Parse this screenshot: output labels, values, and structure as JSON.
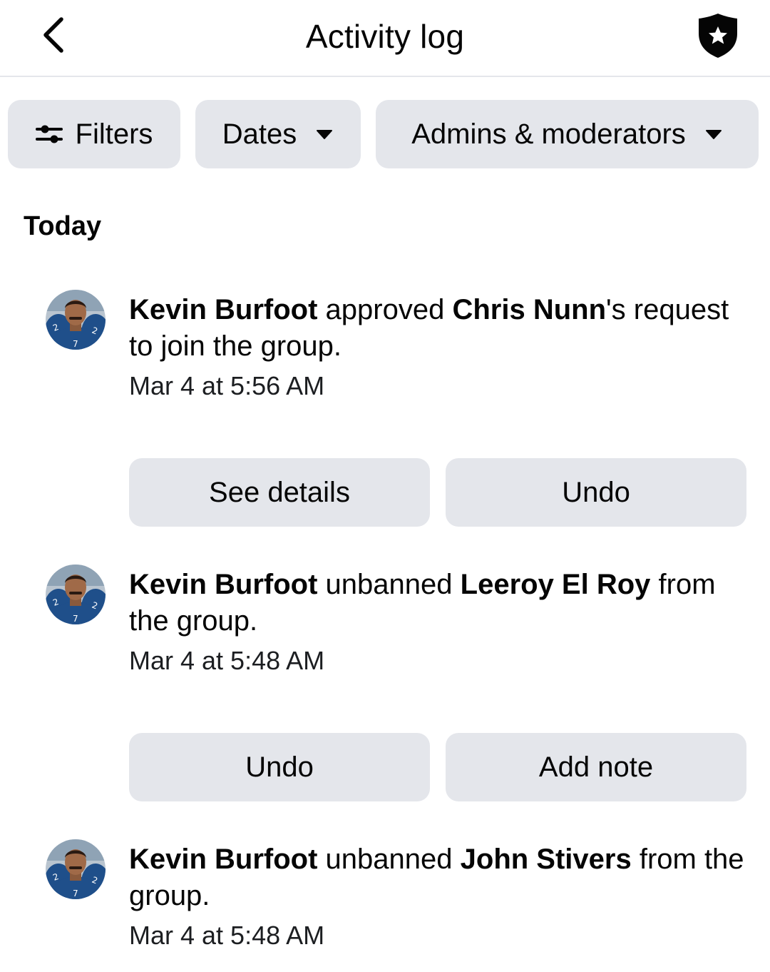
{
  "header": {
    "back_icon": "chevron-left-icon",
    "title": "Activity log",
    "shield_icon": "shield-star-icon"
  },
  "filters": {
    "filters_label": "Filters",
    "filters_icon": "sliders-icon",
    "dates_label": "Dates",
    "admins_label": "Admins & moderators",
    "caret_icon": "caret-down-icon"
  },
  "section": {
    "today": "Today"
  },
  "entries": [
    {
      "actor": "Kevin Burfoot",
      "verb": " approved ",
      "target": "Chris Nunn",
      "rest": "'s request to join the group.",
      "time": "Mar 4 at 5:56 AM",
      "buttons": [
        "See details",
        "Undo"
      ]
    },
    {
      "actor": "Kevin Burfoot",
      "verb": " unbanned ",
      "target": "Leeroy El Roy",
      "rest": " from the group.",
      "time": "Mar 4 at 5:48 AM",
      "buttons": [
        "Undo",
        "Add note"
      ]
    },
    {
      "actor": "Kevin Burfoot",
      "verb": " unbanned ",
      "target": "John Stivers",
      "rest": " from the group.",
      "time": "Mar 4 at 5:48 AM",
      "buttons": []
    }
  ],
  "colors": {
    "chip_bg": "#e4e6eb",
    "text": "#050505",
    "jersey_blue": "#1f4f8a"
  }
}
